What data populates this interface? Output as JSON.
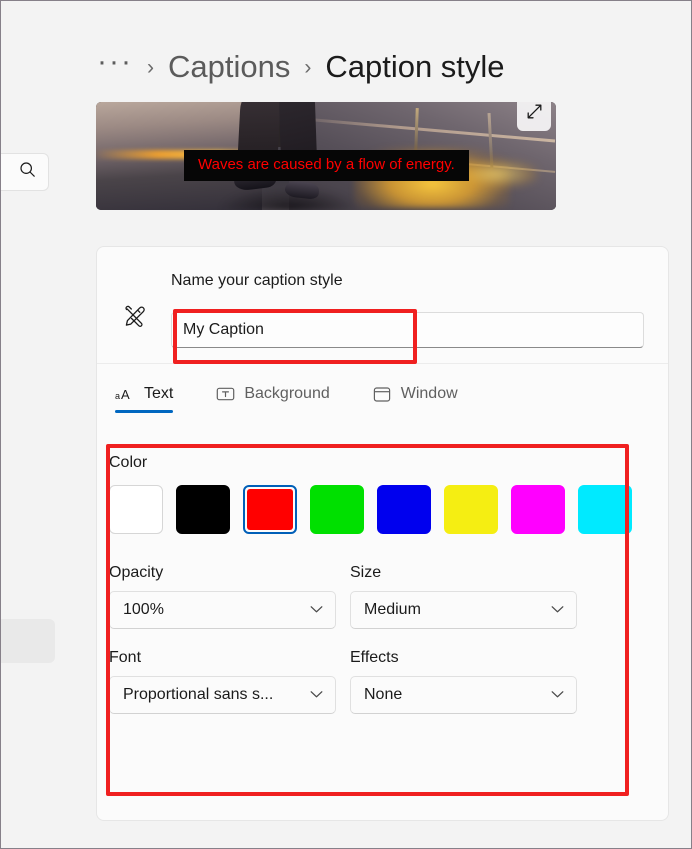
{
  "breadcrumb": {
    "ellipsis": "···",
    "separator": "›",
    "parent": "Captions",
    "current": "Caption style"
  },
  "preview": {
    "caption_text": "Waves are caused by a flow of energy.",
    "caption_color": "#ff0000",
    "caption_background": "#060606",
    "expand_icon": "expand-diagonal-icon"
  },
  "rail": {
    "search_icon": "search-icon"
  },
  "name_section": {
    "icon": "edit-brush-icon",
    "label": "Name your caption style",
    "value": "My Caption",
    "placeholder": "Name your caption style"
  },
  "tabs": [
    {
      "label": "Text",
      "icon": "text-size-aa-icon",
      "active": true
    },
    {
      "label": "Background",
      "icon": "text-background-icon",
      "active": false
    },
    {
      "label": "Window",
      "icon": "window-icon",
      "active": false
    }
  ],
  "settings": {
    "color_label": "Color",
    "swatches": [
      {
        "name": "white",
        "hex": "#ffffff",
        "selected": false
      },
      {
        "name": "black",
        "hex": "#000000",
        "selected": false
      },
      {
        "name": "red",
        "hex": "#ff0000",
        "selected": true
      },
      {
        "name": "green",
        "hex": "#00e000",
        "selected": false
      },
      {
        "name": "blue",
        "hex": "#0000ee",
        "selected": false
      },
      {
        "name": "yellow",
        "hex": "#f5ee12",
        "selected": false
      },
      {
        "name": "magenta",
        "hex": "#ff00ff",
        "selected": false
      },
      {
        "name": "cyan",
        "hex": "#00eaff",
        "selected": false
      }
    ],
    "selection_ring_color": "#005fb8",
    "fields": [
      {
        "label": "Opacity",
        "value": "100%"
      },
      {
        "label": "Size",
        "value": "Medium"
      },
      {
        "label": "Font",
        "value": "Proportional sans s..."
      },
      {
        "label": "Effects",
        "value": "None"
      }
    ]
  },
  "annotations": {
    "color": "#f02020",
    "boxes": [
      "name-input-highlight",
      "text-settings-highlight"
    ]
  }
}
